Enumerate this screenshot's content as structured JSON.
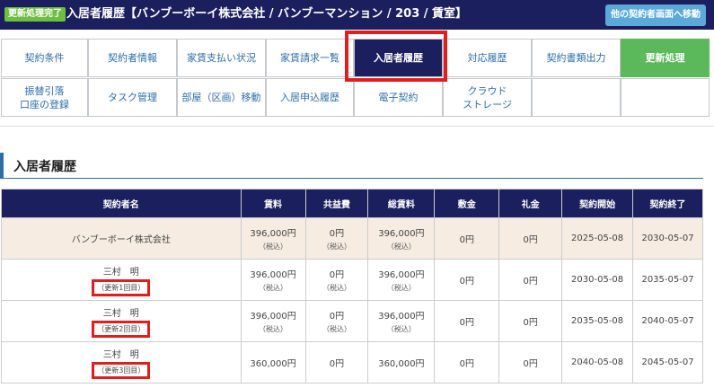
{
  "header": {
    "badge": "更新処理完了",
    "title": "入居者履歴【バンブーボーイ株式会社 / バンブーマンション / 203 / 賃室】",
    "other_contract_button": "他の契約者画面へ移動"
  },
  "tabs": [
    {
      "label": "契約条件"
    },
    {
      "label": "契約者情報"
    },
    {
      "label": "家賃支払い状況"
    },
    {
      "label": "家賃請求一覧"
    },
    {
      "label": "入居者履歴"
    },
    {
      "label": "対応履歴"
    },
    {
      "label": "契約書類出力"
    },
    {
      "label": "更新処理"
    },
    {
      "label": "振替引落\n口座の登録"
    },
    {
      "label": "タスク管理"
    },
    {
      "label": "部屋（区画）移動"
    },
    {
      "label": "入居申込履歴"
    },
    {
      "label": "電子契約"
    },
    {
      "label": "クラウド\nストレージ"
    }
  ],
  "section": {
    "title": "入居者履歴"
  },
  "table": {
    "headers": [
      "契約者名",
      "賃料",
      "共益費",
      "総賃料",
      "敷金",
      "礼金",
      "契約開始",
      "契約終了"
    ],
    "tax_note": "（税込）",
    "rows": [
      {
        "name": "バンブーボーイ株式会社",
        "renewal": "",
        "rent": "396,000円",
        "rent_tax": "（税込）",
        "common": "0円",
        "common_tax": "（税込）",
        "total": "396,000円",
        "total_tax": "（税込）",
        "deposit": "0円",
        "key_money": "0円",
        "start": "2025-05-08",
        "end": "2030-05-07"
      },
      {
        "name": "三村　明",
        "renewal": "（更新1回目）",
        "rent": "396,000円",
        "rent_tax": "（税込）",
        "common": "0円",
        "common_tax": "（税込）",
        "total": "396,000円",
        "total_tax": "（税込）",
        "deposit": "0円",
        "key_money": "0円",
        "start": "2030-05-08",
        "end": "2035-05-07"
      },
      {
        "name": "三村　明",
        "renewal": "（更新2回目）",
        "rent": "396,000円",
        "rent_tax": "（税込）",
        "common": "0円",
        "common_tax": "（税込）",
        "total": "396,000円",
        "total_tax": "（税込）",
        "deposit": "0円",
        "key_money": "0円",
        "start": "2035-05-08",
        "end": "2040-05-07"
      },
      {
        "name": "三村　明",
        "renewal": "（更新3回目）",
        "rent": "360,000円",
        "rent_tax": "",
        "common": "0円",
        "common_tax": "",
        "total": "360,000円",
        "total_tax": "",
        "deposit": "0円",
        "key_money": "0円",
        "start": "2040-05-08",
        "end": "2045-05-07"
      }
    ]
  },
  "colors": {
    "header_bg": "#1c1f5e",
    "badge_bg": "#6ebe3f",
    "update_tab": "#5bb85b",
    "link_blue": "#2d6ea9",
    "owner_row_bg": "#f6ece2",
    "highlight_red": "#e01e1e"
  }
}
